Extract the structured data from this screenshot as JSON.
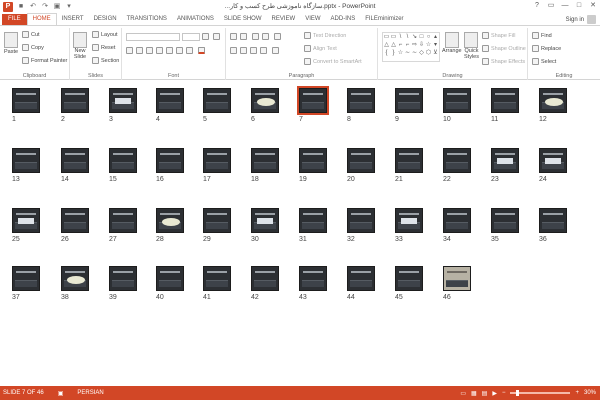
{
  "app": {
    "window_title": "...سازگاه ناموزشی طرح کسب و کار.pptx - PowerPoint",
    "sign_in": "Sign in",
    "window_controls": [
      "?",
      "▭",
      "—",
      "□",
      "✕"
    ]
  },
  "tabs": [
    "FILE",
    "HOME",
    "INSERT",
    "DESIGN",
    "TRANSITIONS",
    "ANIMATIONS",
    "SLIDE SHOW",
    "REVIEW",
    "VIEW",
    "ADD-INS",
    "FILEminimizer"
  ],
  "active_tab": "HOME",
  "ribbon": {
    "clipboard": {
      "label": "Clipboard",
      "paste": "Paste",
      "cut": "Cut",
      "copy": "Copy",
      "format_painter": "Format Painter"
    },
    "slides": {
      "label": "Slides",
      "new_slide_line1": "New",
      "new_slide_line2": "Slide",
      "layout": "Layout",
      "reset": "Reset",
      "section": "Section"
    },
    "font": {
      "label": "Font"
    },
    "paragraph": {
      "label": "Paragraph",
      "text_direction": "Text Direction",
      "align_text": "Align Text",
      "convert_smartart": "Convert to SmartArt"
    },
    "drawing": {
      "label": "Drawing",
      "arrange": "Arrange",
      "quick_styles_line1": "Quick",
      "quick_styles_line2": "Styles",
      "shape_fill": "Shape Fill",
      "shape_outline": "Shape Outline",
      "shape_effects": "Shape Effects"
    },
    "editing": {
      "label": "Editing",
      "find": "Find",
      "replace": "Replace",
      "select": "Select"
    }
  },
  "slides": [
    {
      "n": "1",
      "v": "t"
    },
    {
      "n": "2",
      "v": "t"
    },
    {
      "n": "3",
      "v": "b"
    },
    {
      "n": "4",
      "v": "t"
    },
    {
      "n": "5",
      "v": "t"
    },
    {
      "n": "6",
      "v": "o"
    },
    {
      "n": "7",
      "v": "t",
      "selected": true
    },
    {
      "n": "8",
      "v": "t"
    },
    {
      "n": "9",
      "v": "t"
    },
    {
      "n": "10",
      "v": "t"
    },
    {
      "n": "11",
      "v": "t"
    },
    {
      "n": "12",
      "v": "o"
    },
    {
      "n": "13",
      "v": "t"
    },
    {
      "n": "14",
      "v": "t"
    },
    {
      "n": "15",
      "v": "t"
    },
    {
      "n": "16",
      "v": "t"
    },
    {
      "n": "17",
      "v": "t"
    },
    {
      "n": "18",
      "v": "t"
    },
    {
      "n": "19",
      "v": "t"
    },
    {
      "n": "20",
      "v": "t"
    },
    {
      "n": "21",
      "v": "t"
    },
    {
      "n": "22",
      "v": "t"
    },
    {
      "n": "23",
      "v": "b"
    },
    {
      "n": "24",
      "v": "b"
    },
    {
      "n": "25",
      "v": "b"
    },
    {
      "n": "26",
      "v": "t"
    },
    {
      "n": "27",
      "v": "t"
    },
    {
      "n": "28",
      "v": "o"
    },
    {
      "n": "29",
      "v": "t"
    },
    {
      "n": "30",
      "v": "b"
    },
    {
      "n": "31",
      "v": "t"
    },
    {
      "n": "32",
      "v": "t"
    },
    {
      "n": "33",
      "v": "b"
    },
    {
      "n": "34",
      "v": "t"
    },
    {
      "n": "35",
      "v": "t"
    },
    {
      "n": "36",
      "v": "t"
    },
    {
      "n": "37",
      "v": "t"
    },
    {
      "n": "38",
      "v": "o"
    },
    {
      "n": "39",
      "v": "t"
    },
    {
      "n": "40",
      "v": "t"
    },
    {
      "n": "41",
      "v": "t"
    },
    {
      "n": "42",
      "v": "t"
    },
    {
      "n": "43",
      "v": "t"
    },
    {
      "n": "44",
      "v": "t"
    },
    {
      "n": "45",
      "v": "t"
    },
    {
      "n": "46",
      "v": "p"
    }
  ],
  "status": {
    "slide": "SLIDE 7 OF 46",
    "language": "PERSIAN",
    "zoom": "30%"
  },
  "colors": {
    "accent": "#d24726",
    "thumb_bg": "#2c2f33"
  }
}
